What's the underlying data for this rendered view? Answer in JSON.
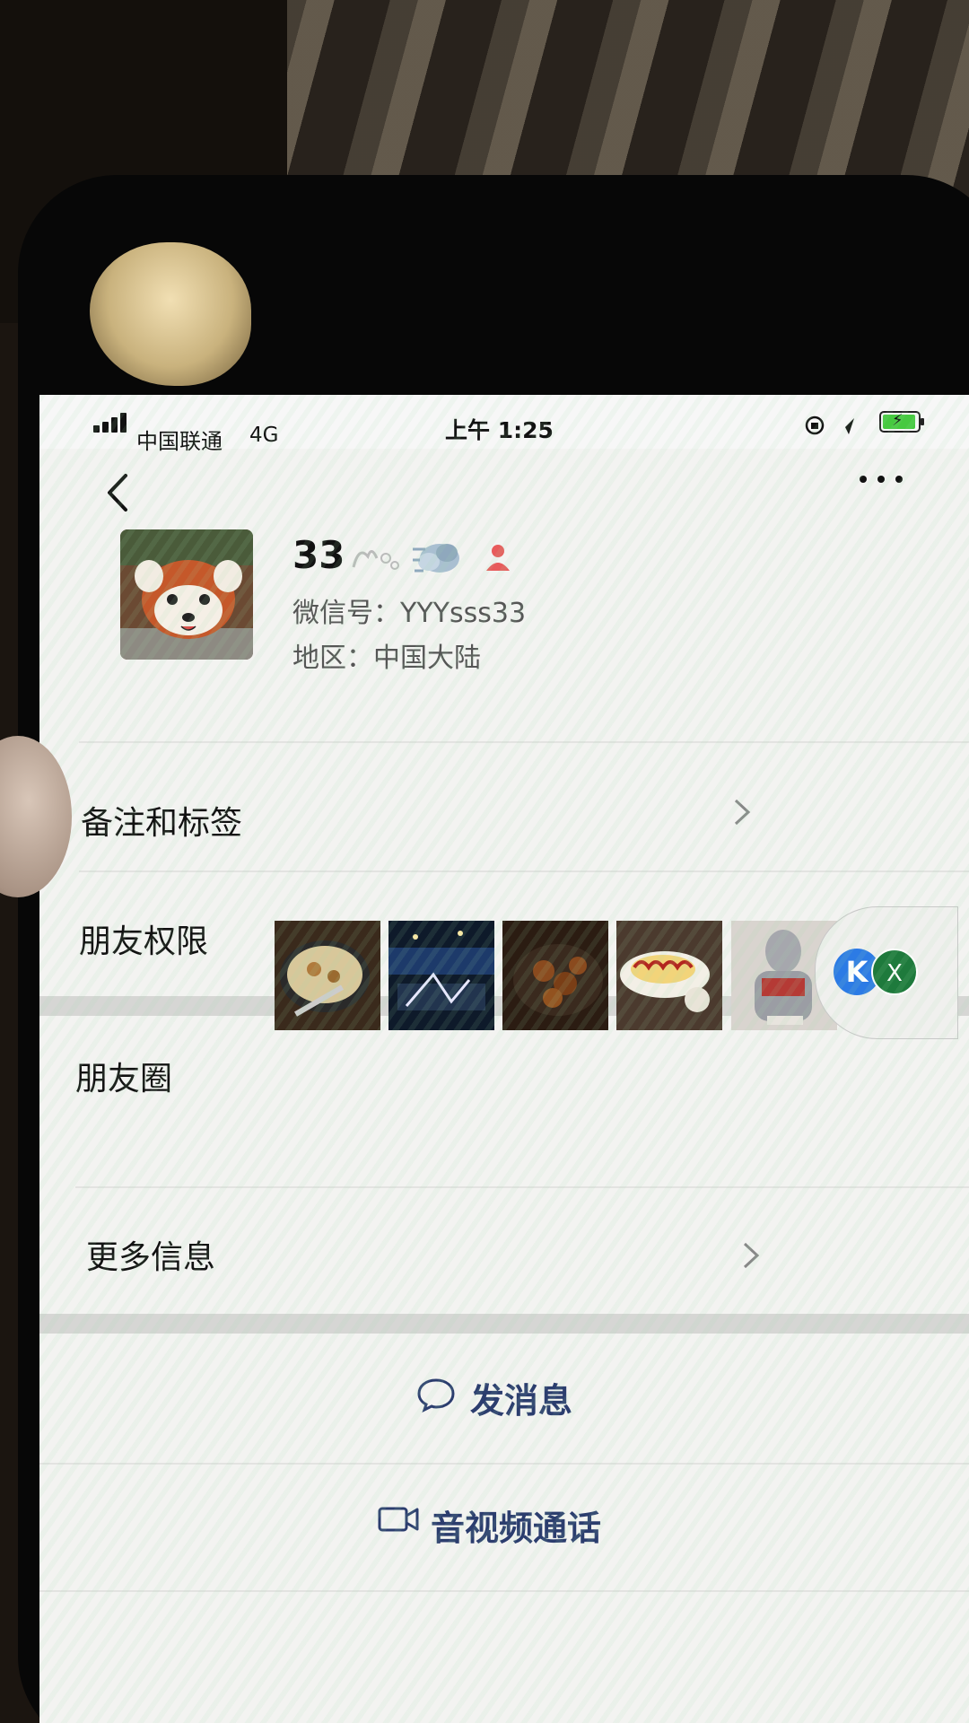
{
  "status_bar": {
    "carrier": "中国联通",
    "network": "4G",
    "time": "上午 1:25"
  },
  "header": {
    "back_icon": "chevron-left-icon",
    "more_icon": "more-dots-icon"
  },
  "profile": {
    "nickname": "33",
    "wechat_id": "微信号：YYYsss33",
    "region": "地区：中国大陆"
  },
  "rows": {
    "remark_tags": "备注和标签",
    "friend_permissions": "朋友权限",
    "moments": "朋友圈",
    "more_info": "更多信息"
  },
  "floater": {
    "k_label": "K",
    "x_label": "X"
  },
  "actions": {
    "send_message": "发消息",
    "video_call": "音视频通话"
  },
  "colors": {
    "action_text": "#2b3d6e",
    "battery": "#46c940"
  }
}
